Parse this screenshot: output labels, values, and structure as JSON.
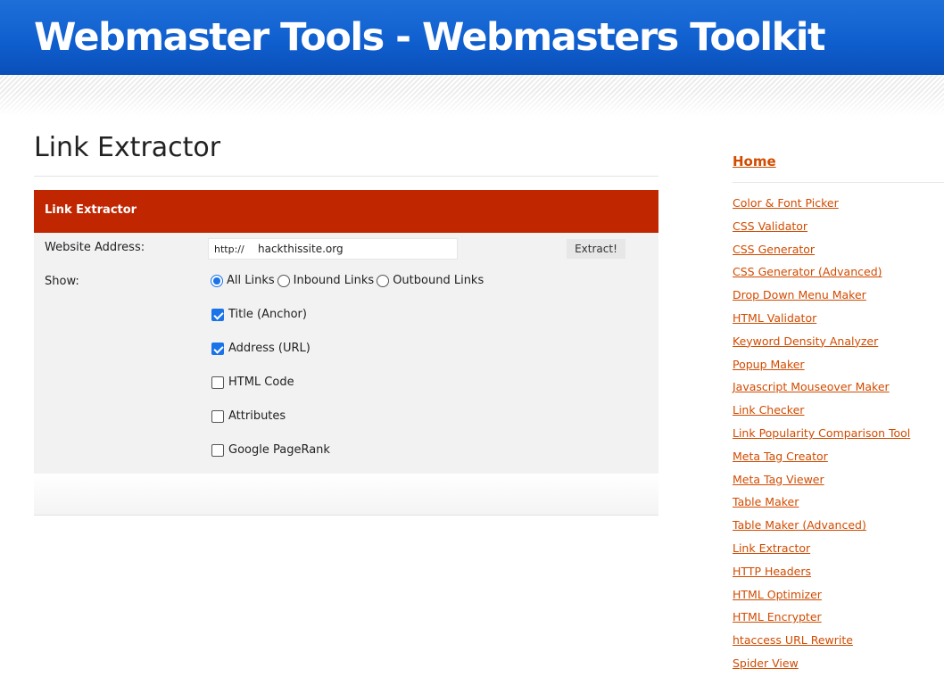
{
  "header": {
    "site_title": "Webmaster Tools - Webmasters Toolkit"
  },
  "main": {
    "page_title": "Link Extractor",
    "panel_title": "Link Extractor",
    "website_address_label": "Website Address:",
    "url_prefix": "http://",
    "url_value": "hackthissite.org",
    "extract_button": "Extract!",
    "show_label": "Show:",
    "radio_options": [
      {
        "label": "All Links",
        "selected": true
      },
      {
        "label": "Inbound Links",
        "selected": false
      },
      {
        "label": "Outbound Links",
        "selected": false
      }
    ],
    "checkboxes": [
      {
        "label": "Title (Anchor)",
        "checked": true
      },
      {
        "label": "Address (URL)",
        "checked": true
      },
      {
        "label": "HTML Code",
        "checked": false
      },
      {
        "label": "Attributes",
        "checked": false
      },
      {
        "label": "Google PageRank",
        "checked": false
      }
    ]
  },
  "sidebar": {
    "home": "Home",
    "links": [
      "Color & Font Picker",
      "CSS Validator",
      "CSS Generator",
      "CSS Generator (Advanced)",
      "Drop Down Menu Maker",
      "HTML Validator",
      "Keyword Density Analyzer",
      "Popup Maker",
      "Javascript Mouseover Maker",
      "Link Checker",
      "Link Popularity Comparison Tool",
      "Meta Tag Creator",
      "Meta Tag Viewer",
      "Table Maker",
      "Table Maker (Advanced)",
      "Link Extractor",
      "HTTP Headers",
      "HTML Optimizer",
      "HTML Encrypter",
      "htaccess URL Rewrite",
      "Spider View"
    ]
  },
  "colors": {
    "banner_blue": "#0f5fcf",
    "panel_header_red": "#c02600",
    "link_orange": "#d14b00",
    "control_blue": "#1a73e8"
  }
}
